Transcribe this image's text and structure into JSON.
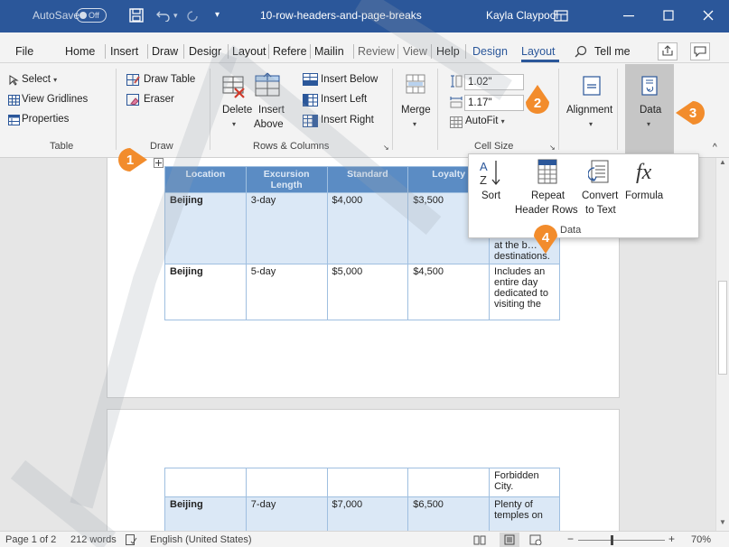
{
  "titlebar": {
    "autosave_label": "AutoSave",
    "autosave_state": "Off",
    "doc_title": "10-row-headers-and-page-breaks",
    "user": "Kayla Claypool"
  },
  "menu": {
    "tabs": [
      "File",
      "Home",
      "Insert",
      "Draw",
      "Desigr",
      "Layout",
      "Refere",
      "Mailin",
      "Review",
      "View",
      "Help"
    ],
    "ctx_design": "Design",
    "ctx_layout": "Layout",
    "tellme": "Tell me"
  },
  "ribbon": {
    "table": {
      "select": "Select",
      "gridlines": "View Gridlines",
      "properties": "Properties",
      "label": "Table"
    },
    "draw": {
      "draw_table": "Draw Table",
      "eraser": "Eraser",
      "label": "Draw"
    },
    "rows": {
      "delete": "Delete",
      "insert": "Insert",
      "above": "Above",
      "below": "Insert Below",
      "left": "Insert Left",
      "right": "Insert Right",
      "label": "Rows & Columns"
    },
    "merge": {
      "label": "Merge"
    },
    "cellsize": {
      "height": "1.02\"",
      "width": "1.17\"",
      "autofit": "AutoFit",
      "label": "Cell Size"
    },
    "alignment": {
      "label": "Alignment"
    },
    "data": {
      "label": "Data"
    }
  },
  "popup": {
    "sort": "Sort",
    "repeat_1": "Repeat",
    "repeat_2": "Header Rows",
    "convert_1": "Convert",
    "convert_2": "to Text",
    "formula": "Formula",
    "label": "Data"
  },
  "table": {
    "headers": [
      "Location",
      "Excursion Length",
      "Standard",
      "Loyalty",
      ""
    ],
    "rows": [
      {
        "location": "Beijing",
        "length": "3-day",
        "standard": "$4,000",
        "loyalty": "$3,500",
        "desc": "at the b… destinations."
      },
      {
        "location": "Beijing",
        "length": "5-day",
        "standard": "$5,000",
        "loyalty": "$4,500",
        "desc": "Includes an entire day dedicated to visiting the"
      }
    ],
    "page2_cont": "Forbidden City.",
    "page2_row": {
      "location": "Beijing",
      "length": "7-day",
      "standard": "$7,000",
      "loyalty": "$6,500",
      "desc": "Plenty of temples on"
    }
  },
  "status": {
    "page": "Page 1 of 2",
    "words": "212 words",
    "language": "English (United States)",
    "zoom": "70%"
  },
  "callouts": [
    "1",
    "2",
    "3",
    "4"
  ],
  "colors": {
    "brand": "#2b579a",
    "callout": "#f28c2c",
    "header_row": "#5b8cc4",
    "row_fill": "#dbe8f6"
  }
}
